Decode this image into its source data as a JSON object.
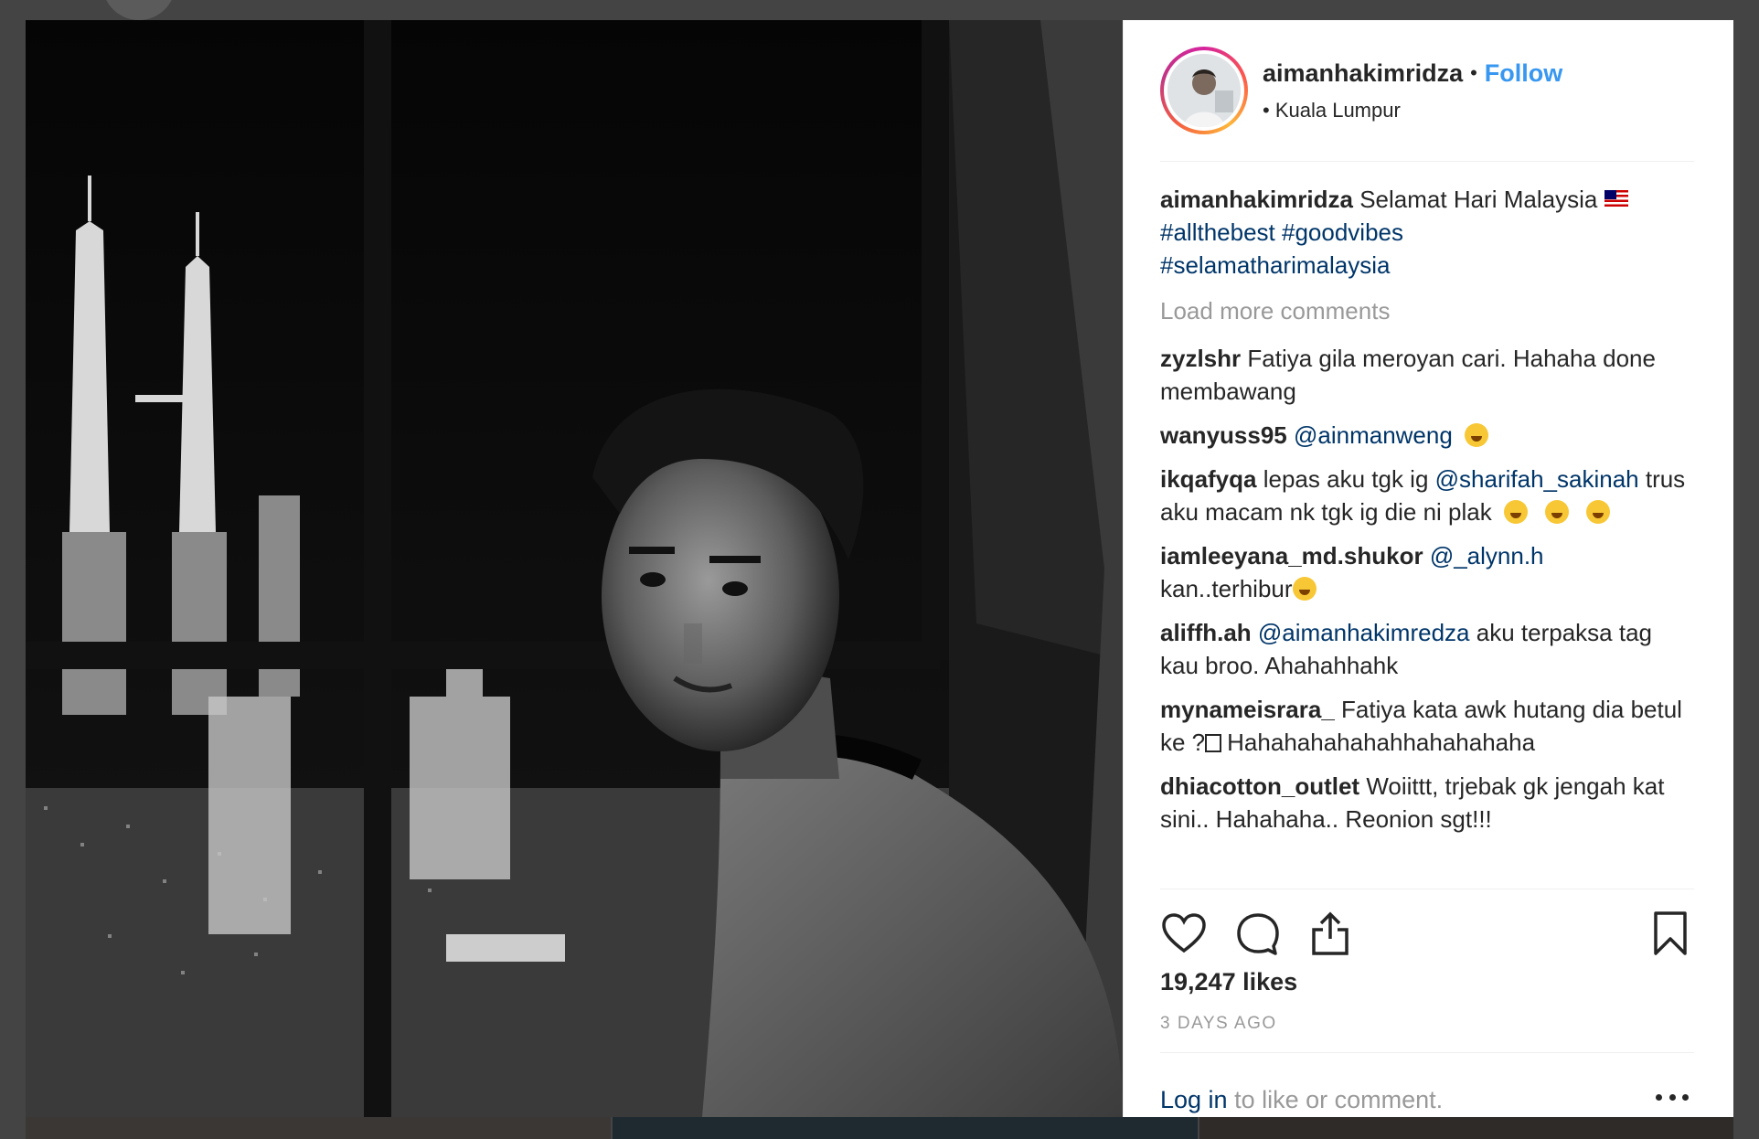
{
  "post": {
    "username": "aimanhakimridza",
    "follow_label": "Follow",
    "location": "Kuala Lumpur",
    "caption_text": "Selamat Hari Malaysia",
    "caption_tags": [
      "#allthebest",
      "#goodvibes",
      "#selamatharimalaysia"
    ],
    "load_more_label": "Load more comments",
    "likes": "19,247 likes",
    "posted_ago": "3 DAYS AGO",
    "login_link": "Log in",
    "login_rest": " to like or comment."
  },
  "comments": [
    {
      "user": "zyzlshr",
      "text": "Fatiya gila meroyan cari. Hahaha done membawang"
    },
    {
      "user": "wanyuss95",
      "mention": "@ainmanweng",
      "text": ""
    },
    {
      "user": "ikqafyqa",
      "text_before": "lepas aku tgk ig",
      "mention": "@sharifah_sakinah",
      "text": "trus aku macam nk tgk ig die ni plak"
    },
    {
      "user": "iamleeyana_md.shukor",
      "mention": "@_alynn.h",
      "text": "kan..terhibur"
    },
    {
      "user": "aliffh.ah",
      "mention": "@aimanhakimredza",
      "text": "aku terpaksa tag kau broo. Ahahahhahk"
    },
    {
      "user": "mynameisrara_",
      "text_before": "Fatiya kata awk hutang dia betul ke ?",
      "text": "Hahahahahahahhahahahaha"
    },
    {
      "user": "dhiacotton_outlet",
      "text": "Woiittt, trjebak gk jengah kat sini.. Hahahaha.. Reonion sgt!!!"
    }
  ],
  "icons": {
    "like": "heart-icon",
    "comment": "comment-icon",
    "share": "share-icon",
    "save": "bookmark-icon",
    "more": "more-options-icon"
  },
  "colors": {
    "follow": "#3897f0",
    "link": "#003569",
    "muted": "#999999",
    "text": "#262626"
  }
}
